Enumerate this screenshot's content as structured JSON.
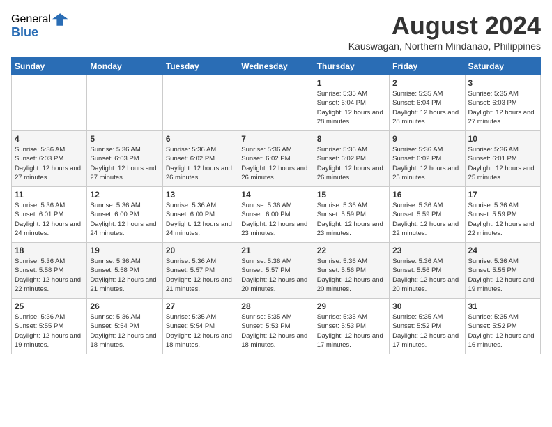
{
  "header": {
    "logo_general": "General",
    "logo_blue": "Blue",
    "month_year": "August 2024",
    "location": "Kauswagan, Northern Mindanao, Philippines"
  },
  "weekdays": [
    "Sunday",
    "Monday",
    "Tuesday",
    "Wednesday",
    "Thursday",
    "Friday",
    "Saturday"
  ],
  "weeks": [
    [
      {
        "day": "",
        "empty": true
      },
      {
        "day": "",
        "empty": true
      },
      {
        "day": "",
        "empty": true
      },
      {
        "day": "",
        "empty": true
      },
      {
        "day": "1",
        "sunrise": "5:35 AM",
        "sunset": "6:04 PM",
        "daylight": "12 hours and 28 minutes."
      },
      {
        "day": "2",
        "sunrise": "5:35 AM",
        "sunset": "6:04 PM",
        "daylight": "12 hours and 28 minutes."
      },
      {
        "day": "3",
        "sunrise": "5:35 AM",
        "sunset": "6:03 PM",
        "daylight": "12 hours and 27 minutes."
      }
    ],
    [
      {
        "day": "4",
        "sunrise": "5:36 AM",
        "sunset": "6:03 PM",
        "daylight": "12 hours and 27 minutes."
      },
      {
        "day": "5",
        "sunrise": "5:36 AM",
        "sunset": "6:03 PM",
        "daylight": "12 hours and 27 minutes."
      },
      {
        "day": "6",
        "sunrise": "5:36 AM",
        "sunset": "6:02 PM",
        "daylight": "12 hours and 26 minutes."
      },
      {
        "day": "7",
        "sunrise": "5:36 AM",
        "sunset": "6:02 PM",
        "daylight": "12 hours and 26 minutes."
      },
      {
        "day": "8",
        "sunrise": "5:36 AM",
        "sunset": "6:02 PM",
        "daylight": "12 hours and 26 minutes."
      },
      {
        "day": "9",
        "sunrise": "5:36 AM",
        "sunset": "6:02 PM",
        "daylight": "12 hours and 25 minutes."
      },
      {
        "day": "10",
        "sunrise": "5:36 AM",
        "sunset": "6:01 PM",
        "daylight": "12 hours and 25 minutes."
      }
    ],
    [
      {
        "day": "11",
        "sunrise": "5:36 AM",
        "sunset": "6:01 PM",
        "daylight": "12 hours and 24 minutes."
      },
      {
        "day": "12",
        "sunrise": "5:36 AM",
        "sunset": "6:00 PM",
        "daylight": "12 hours and 24 minutes."
      },
      {
        "day": "13",
        "sunrise": "5:36 AM",
        "sunset": "6:00 PM",
        "daylight": "12 hours and 24 minutes."
      },
      {
        "day": "14",
        "sunrise": "5:36 AM",
        "sunset": "6:00 PM",
        "daylight": "12 hours and 23 minutes."
      },
      {
        "day": "15",
        "sunrise": "5:36 AM",
        "sunset": "5:59 PM",
        "daylight": "12 hours and 23 minutes."
      },
      {
        "day": "16",
        "sunrise": "5:36 AM",
        "sunset": "5:59 PM",
        "daylight": "12 hours and 22 minutes."
      },
      {
        "day": "17",
        "sunrise": "5:36 AM",
        "sunset": "5:59 PM",
        "daylight": "12 hours and 22 minutes."
      }
    ],
    [
      {
        "day": "18",
        "sunrise": "5:36 AM",
        "sunset": "5:58 PM",
        "daylight": "12 hours and 22 minutes."
      },
      {
        "day": "19",
        "sunrise": "5:36 AM",
        "sunset": "5:58 PM",
        "daylight": "12 hours and 21 minutes."
      },
      {
        "day": "20",
        "sunrise": "5:36 AM",
        "sunset": "5:57 PM",
        "daylight": "12 hours and 21 minutes."
      },
      {
        "day": "21",
        "sunrise": "5:36 AM",
        "sunset": "5:57 PM",
        "daylight": "12 hours and 20 minutes."
      },
      {
        "day": "22",
        "sunrise": "5:36 AM",
        "sunset": "5:56 PM",
        "daylight": "12 hours and 20 minutes."
      },
      {
        "day": "23",
        "sunrise": "5:36 AM",
        "sunset": "5:56 PM",
        "daylight": "12 hours and 20 minutes."
      },
      {
        "day": "24",
        "sunrise": "5:36 AM",
        "sunset": "5:55 PM",
        "daylight": "12 hours and 19 minutes."
      }
    ],
    [
      {
        "day": "25",
        "sunrise": "5:36 AM",
        "sunset": "5:55 PM",
        "daylight": "12 hours and 19 minutes."
      },
      {
        "day": "26",
        "sunrise": "5:36 AM",
        "sunset": "5:54 PM",
        "daylight": "12 hours and 18 minutes."
      },
      {
        "day": "27",
        "sunrise": "5:35 AM",
        "sunset": "5:54 PM",
        "daylight": "12 hours and 18 minutes."
      },
      {
        "day": "28",
        "sunrise": "5:35 AM",
        "sunset": "5:53 PM",
        "daylight": "12 hours and 18 minutes."
      },
      {
        "day": "29",
        "sunrise": "5:35 AM",
        "sunset": "5:53 PM",
        "daylight": "12 hours and 17 minutes."
      },
      {
        "day": "30",
        "sunrise": "5:35 AM",
        "sunset": "5:52 PM",
        "daylight": "12 hours and 17 minutes."
      },
      {
        "day": "31",
        "sunrise": "5:35 AM",
        "sunset": "5:52 PM",
        "daylight": "12 hours and 16 minutes."
      }
    ]
  ]
}
